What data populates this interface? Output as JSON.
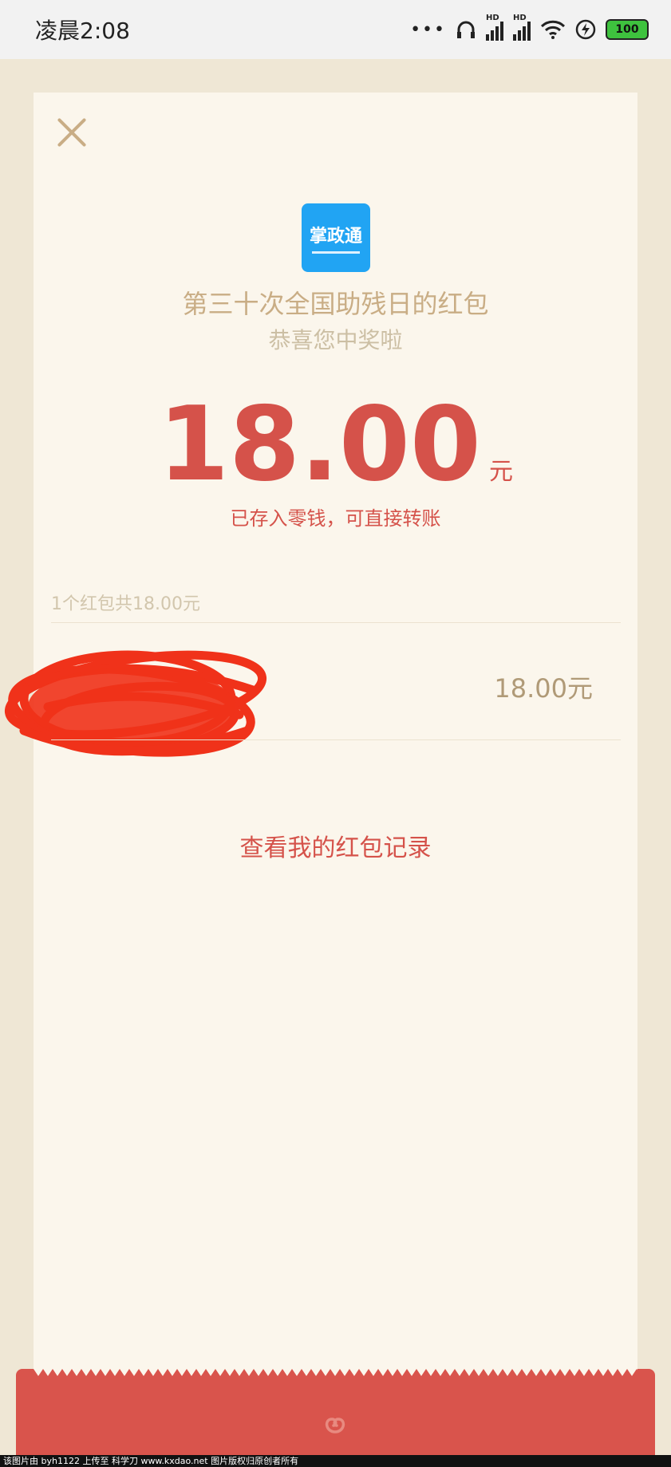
{
  "status_bar": {
    "time": "凌晨2:08",
    "dots": "•••",
    "battery": "100"
  },
  "card": {
    "logo_text": "掌政通",
    "title": "第三十次全国助残日的红包",
    "subtitle": "恭喜您中奖啦",
    "amount": "18.00",
    "unit": "元",
    "stored_note": "已存入零钱，可直接转账",
    "summary": "1个红包共18.00元",
    "record_amount": "18.00元",
    "history_link": "查看我的红包记录"
  },
  "footer": {
    "watermark": "该图片由 byh1122 上传至 科学刀 www.kxdao.net 图片版权归原创者所有"
  },
  "colors": {
    "accent_red": "#d5524a",
    "gold": "#c9ad85",
    "card_bg": "#fbf6ec",
    "page_bg": "#efe7d5",
    "logo_blue": "#21a4f3"
  }
}
